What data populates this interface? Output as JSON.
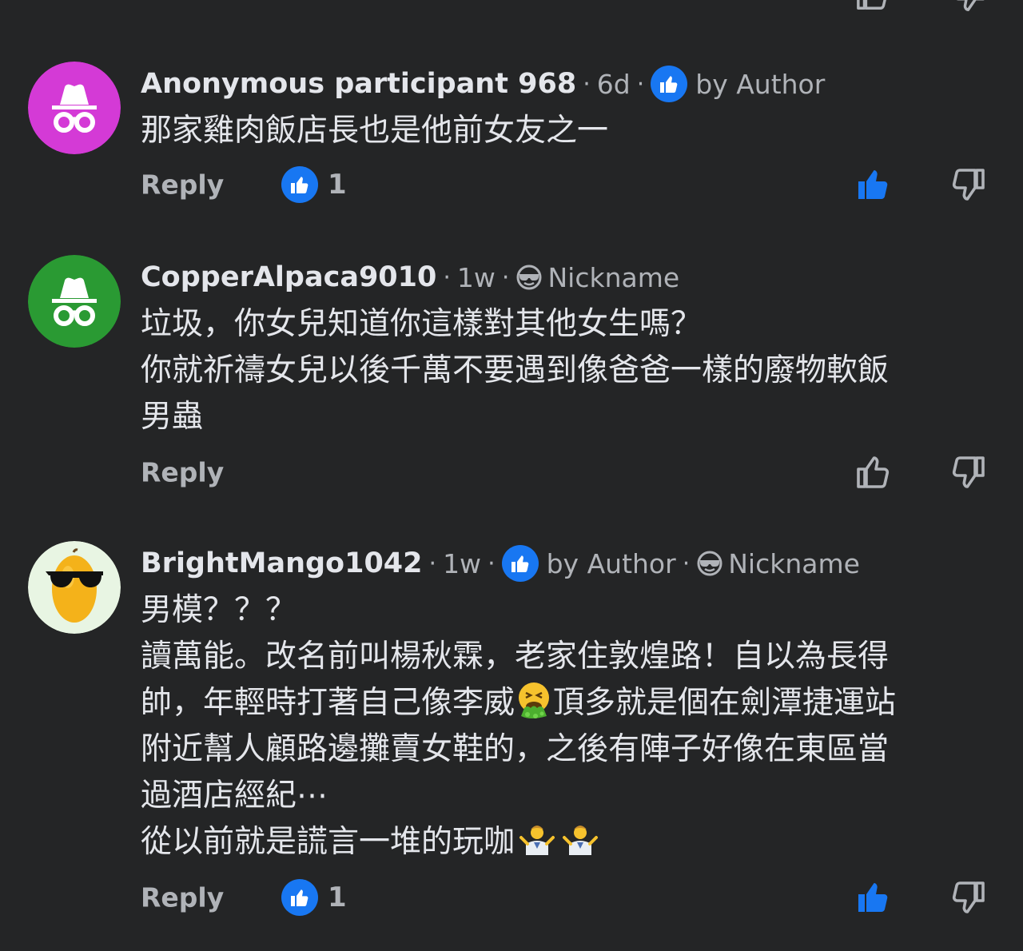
{
  "colors": {
    "background": "#242526",
    "text_primary": "#e4e6eb",
    "text_secondary": "#b0b3b8",
    "like_blue": "#1877f2",
    "avatar_magenta": "#d43ad6",
    "avatar_green": "#2a9a33",
    "avatar_mint": "#e8f5e3"
  },
  "comments": [
    {
      "username": "Anonymous participant 968",
      "age": "6d",
      "author_badge": "by Author",
      "nickname_badge": null,
      "avatar": "anonymous-magenta",
      "lines": [
        "那家雞肉飯店長也是他前女友之一"
      ],
      "reply_label": "Reply",
      "like_count": "1",
      "liked": true
    },
    {
      "username": "CopperAlpaca9010",
      "age": "1w",
      "author_badge": null,
      "nickname_badge": "Nickname",
      "avatar": "anonymous-green",
      "lines": [
        "垃圾，你女兒知道你這樣對其他女生嗎？",
        "你就祈禱女兒以後千萬不要遇到像爸爸一樣的廢物軟飯",
        "男蟲"
      ],
      "reply_label": "Reply",
      "like_count": null,
      "liked": false
    },
    {
      "username": "BrightMango1042",
      "age": "1w",
      "author_badge": "by Author",
      "nickname_badge": "Nickname",
      "avatar": "mango-sunglasses",
      "lines": [
        "男模？？？",
        "讀萬能。改名前叫楊秋霖，老家住敦煌路！自以為長得",
        "帥，年輕時打著自己像李威",
        "頂多就是個在劍潭捷運站",
        "附近幫人顧路邊攤賣女鞋的，之後有陣子好像在東區當",
        "過酒店經紀⋯",
        "從以前就是謊言一堆的玩咖"
      ],
      "reply_label": "Reply",
      "like_count": "1",
      "liked": true
    }
  ],
  "icons": {
    "like_badge": "thumbs-up-icon",
    "thumb_up": "thumb-up-icon",
    "thumb_down": "thumb-down-icon",
    "nickname": "sunglasses-face-icon",
    "vomit_emoji": "face-vomiting-icon",
    "shrug_emoji": "person-shrugging-icon"
  }
}
